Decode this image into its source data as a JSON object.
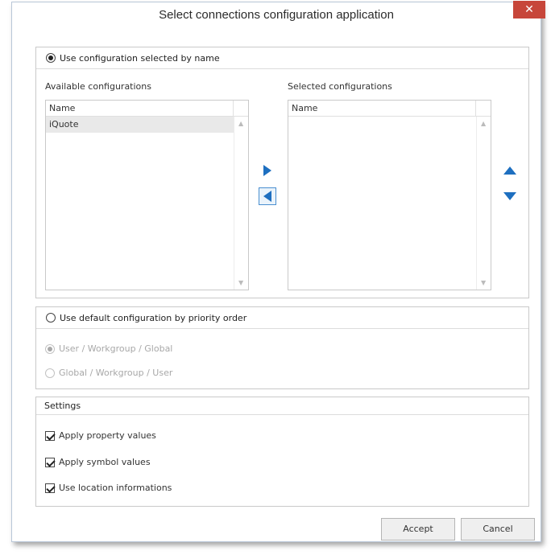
{
  "window": {
    "title": "Select connections configuration application",
    "close_glyph": "✕"
  },
  "by_name": {
    "label": "Use configuration selected by name",
    "selected": true,
    "available_label": "Available configurations",
    "selected_label": "Selected configurations",
    "available": {
      "column": "Name",
      "items": [
        "iQuote"
      ]
    },
    "chosen": {
      "column": "Name",
      "items": []
    }
  },
  "priority": {
    "label": "Use default configuration by priority order",
    "selected": false,
    "options": [
      {
        "label": "User / Workgroup / Global",
        "selected": true
      },
      {
        "label": "Global / Workgroup / User",
        "selected": false
      }
    ]
  },
  "settings": {
    "title": "Settings",
    "checks": [
      {
        "label": "Apply property values",
        "checked": true
      },
      {
        "label": "Apply symbol values",
        "checked": true
      },
      {
        "label": "Use location informations",
        "checked": true
      }
    ]
  },
  "buttons": {
    "accept": "Accept",
    "cancel": "Cancel"
  },
  "icons": {
    "move_right": "arrow-right-icon",
    "move_left": "arrow-left-icon",
    "move_up": "arrow-up-icon",
    "move_down": "arrow-down-icon"
  },
  "colors": {
    "accent": "#1e6fc0",
    "close": "#c7463a"
  }
}
